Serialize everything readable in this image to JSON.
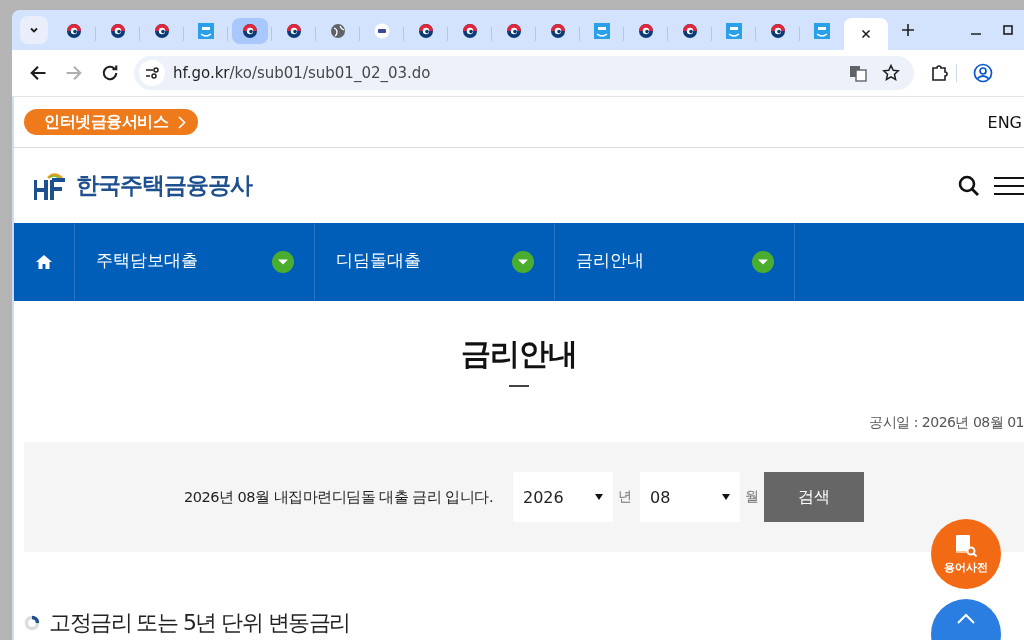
{
  "browser": {
    "tabs": [
      {
        "kind": "emblem",
        "selected": false,
        "hovered": false
      },
      {
        "kind": "emblem",
        "selected": false,
        "hovered": false
      },
      {
        "kind": "emblem",
        "selected": false,
        "hovered": false
      },
      {
        "kind": "app",
        "selected": false,
        "hovered": false
      },
      {
        "kind": "emblem",
        "selected": false,
        "hovered": true
      },
      {
        "kind": "emblem",
        "selected": false,
        "hovered": false
      },
      {
        "kind": "globe",
        "selected": false,
        "hovered": false
      },
      {
        "kind": "seal",
        "selected": false,
        "hovered": false
      },
      {
        "kind": "emblem",
        "selected": false,
        "hovered": false
      },
      {
        "kind": "emblem",
        "selected": false,
        "hovered": false
      },
      {
        "kind": "emblem",
        "selected": false,
        "hovered": false
      },
      {
        "kind": "emblem",
        "selected": false,
        "hovered": false
      },
      {
        "kind": "app",
        "selected": false,
        "hovered": false
      },
      {
        "kind": "emblem",
        "selected": false,
        "hovered": false
      },
      {
        "kind": "emblem",
        "selected": false,
        "hovered": false
      },
      {
        "kind": "app",
        "selected": false,
        "hovered": false
      },
      {
        "kind": "emblem",
        "selected": false,
        "hovered": false
      },
      {
        "kind": "app",
        "selected": false,
        "hovered": false
      },
      {
        "kind": "blank",
        "selected": true,
        "hovered": false
      }
    ],
    "url": {
      "host": "hf.go.kr",
      "path": "/ko/sub01/sub01_02_03.do"
    }
  },
  "site": {
    "service_button": "인터넷금융서비스",
    "language": "ENG",
    "logo_text": "한국주택금융공사",
    "nav": [
      {
        "label": "주택담보대출",
        "expanded": false
      },
      {
        "label": "디딤돌대출",
        "expanded": false
      },
      {
        "label": "금리안내",
        "expanded": false
      }
    ]
  },
  "page": {
    "title": "금리안내",
    "notice_date": "공시일 : 2026년 08월 01",
    "search": {
      "message": "2026년 08월 내집마련디딤돌 대출 금리 입니다.",
      "year": {
        "value": "2026",
        "unit": "년"
      },
      "month": {
        "value": "08",
        "unit": "월"
      },
      "button": "검색"
    },
    "section_title": "고정금리 또는 5년 단위 변동금리"
  },
  "floating": {
    "glossary": "용어사전"
  }
}
